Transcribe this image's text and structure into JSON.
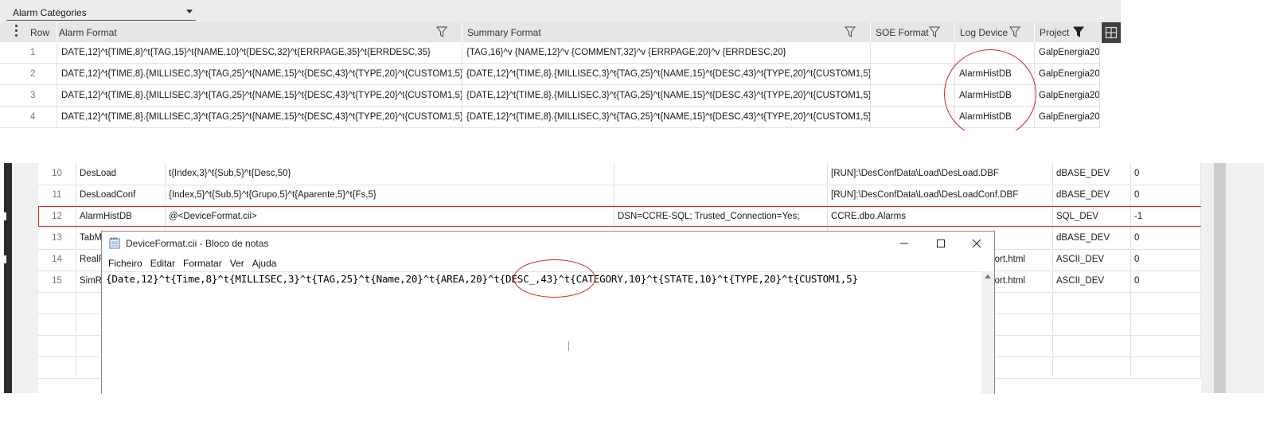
{
  "top_panel": {
    "category_select": {
      "value": "Alarm Categories"
    },
    "columns": [
      "Row",
      "Alarm Format",
      "Summary Format",
      "SOE Format",
      "Log Device",
      "Project"
    ],
    "rows": [
      {
        "row": "1",
        "alarm_format": "DATE,12}^t{TIME,8}^t{TAG,15}^t{NAME,10}^t{DESC,32}^t{ERRPAGE,35}^t{ERRDESC,35}",
        "summary_format": "{TAG,16}^v {NAME,12}^v {COMMENT,32}^v {ERRPAGE,20}^v {ERRDESC,20}",
        "soe_format": "",
        "log_device": "",
        "project": "GalpEnergia20"
      },
      {
        "row": "2",
        "alarm_format": "DATE,12}^t{TIME,8}.{MILLISEC,3}^t{TAG,25}^t{NAME,15}^t{DESC,43}^t{TYPE,20}^t{CUSTOM1,5}",
        "summary_format": "{DATE,12}^t{TIME,8}.{MILLISEC,3}^t{TAG,25}^t{NAME,15}^t{DESC,43}^t{TYPE,20}^t{CUSTOM1,5}",
        "soe_format": "",
        "log_device": "AlarmHistDB",
        "project": "GalpEnergia20"
      },
      {
        "row": "3",
        "alarm_format": "DATE,12}^t{TIME,8}.{MILLISEC,3}^t{TAG,25}^t{NAME,15}^t{DESC,43}^t{TYPE,20}^t{CUSTOM1,5}",
        "summary_format": "{DATE,12}^t{TIME,8}.{MILLISEC,3}^t{TAG,25}^t{NAME,15}^t{DESC,43}^t{TYPE,20}^t{CUSTOM1,5}",
        "soe_format": "",
        "log_device": "AlarmHistDB",
        "project": "GalpEnergia20"
      },
      {
        "row": "4",
        "alarm_format": "DATE,12}^t{TIME,8}.{MILLISEC,3}^t{TAG,25}^t{NAME,15}^t{DESC,43}^t{TYPE,20}^t{CUSTOM1,5}",
        "summary_format": "{DATE,12}^t{TIME,8}.{MILLISEC,3}^t{TAG,25}^t{NAME,15}^t{DESC,43}^t{TYPE,20}^t{CUSTOM1,5}",
        "soe_format": "",
        "log_device": "AlarmHistDB",
        "project": "GalpEnergia20"
      }
    ]
  },
  "bottom_panel": {
    "rows": [
      {
        "num": "10",
        "name": "DesLoad",
        "format": "t{Index,3}^t{Sub,5}^t{Desc,50}",
        "connection": "",
        "file": "[RUN]:\\DesConfData\\Load\\DesLoad.DBF",
        "type": "dBASE_DEV",
        "value": "0"
      },
      {
        "num": "11",
        "name": "DesLoadConf",
        "format": "{Index,5}^t{Sub,5}^t{Grupo,5}^t{Aparente,5}^t{Fs,5}",
        "connection": "",
        "file": "[RUN]:\\DesConfData\\Load\\DesLoadConf.DBF",
        "type": "dBASE_DEV",
        "value": "0"
      },
      {
        "num": "12",
        "name": "AlarmHistDB",
        "format": "@<DeviceFormat.cii>",
        "connection": "DSN=CCRE-SQL; Trusted_Connection=Yes;",
        "file": "CCRE.dbo.Alarms",
        "type": "SQL_DEV",
        "value": "-1"
      },
      {
        "num": "13",
        "name": "TabMo",
        "format": "",
        "connection": "",
        "file": "",
        "type": "dBASE_DEV",
        "value": "0"
      },
      {
        "num": "14",
        "name": "RealR",
        "format": "",
        "connection": "",
        "file": "port.html",
        "type": "ASCII_DEV",
        "value": "0"
      },
      {
        "num": "15",
        "name": "SimRe",
        "format": "",
        "connection": "",
        "file": "port.html",
        "type": "ASCII_DEV",
        "value": "0"
      },
      {
        "num": "",
        "name": "",
        "format": "",
        "connection": "",
        "file": "",
        "type": "",
        "value": ""
      },
      {
        "num": "",
        "name": "",
        "format": "",
        "connection": "",
        "file": "",
        "type": "",
        "value": ""
      },
      {
        "num": "",
        "name": "",
        "format": "",
        "connection": "",
        "file": "",
        "type": "",
        "value": ""
      },
      {
        "num": "",
        "name": "",
        "format": "",
        "connection": "",
        "file": "",
        "type": "",
        "value": ""
      }
    ]
  },
  "notepad": {
    "title": "DeviceFormat.cii - Bloco de notas",
    "menu": [
      "Ficheiro",
      "Editar",
      "Formatar",
      "Ver",
      "Ajuda"
    ],
    "content": "{Date,12}^t{Time,8}^t{MILLISEC,3}^t{TAG,25}^t{Name,20}^t{AREA,20}^t{DESC_,43}^t{CATEGORY,10}^t{STATE,10}^t{TYPE,20}^t{CUSTOM1,5}",
    "icons": {
      "minimize": "minimize-icon",
      "maximize": "maximize-icon",
      "close": "close-icon",
      "app": "notepad-icon"
    }
  },
  "colors": {
    "annotation_red": "#d62020",
    "header_bg": "#e6e6e6",
    "dark_bar": "#2b2b2b"
  }
}
